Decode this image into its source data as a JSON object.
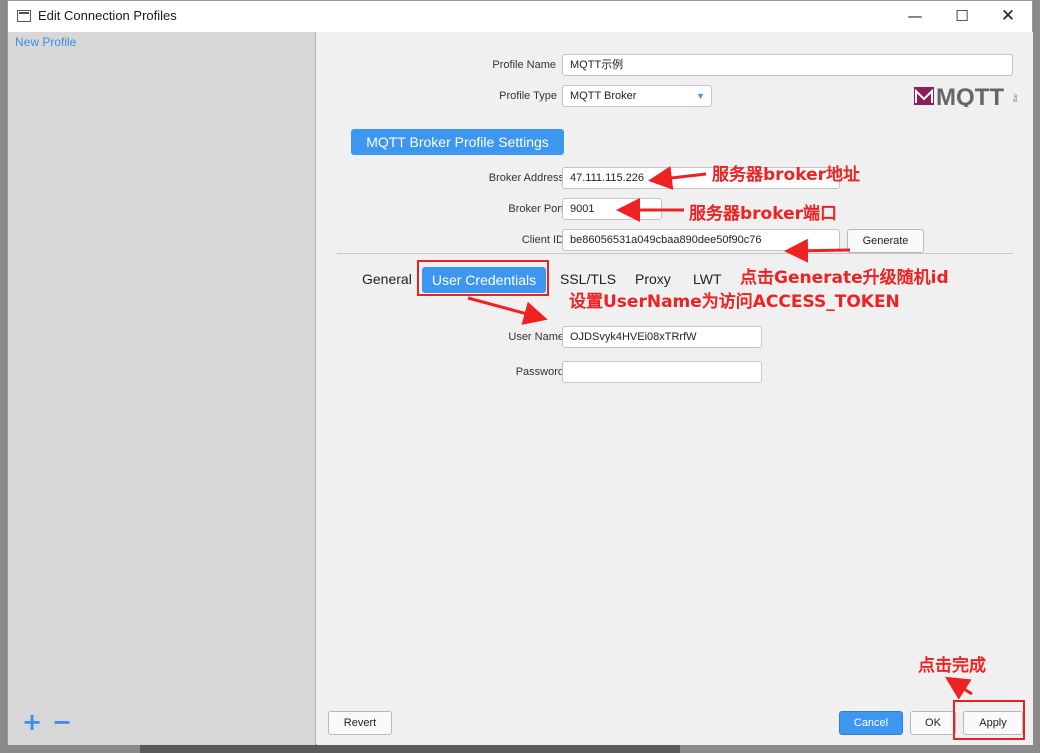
{
  "window": {
    "title": "Edit Connection Profiles"
  },
  "sidebar": {
    "items": [
      {
        "label": "New Profile"
      }
    ],
    "add": "+",
    "remove": "−"
  },
  "profile": {
    "name_label": "Profile Name",
    "name_value": "MQTT示例",
    "type_label": "Profile Type",
    "type_value": "MQTT Broker"
  },
  "logo": {
    "text": "MQTT"
  },
  "section": {
    "title": "MQTT Broker Profile Settings"
  },
  "broker": {
    "address_label": "Broker Address",
    "address_value": "47.111.115.226",
    "port_label": "Broker Port",
    "port_value": "9001",
    "client_id_label": "Client ID",
    "client_id_value": "be86056531a049cbaa890dee50f90c76",
    "generate_label": "Generate"
  },
  "tabs": [
    {
      "label": "General"
    },
    {
      "label": "User Credentials"
    },
    {
      "label": "SSL/TLS"
    },
    {
      "label": "Proxy"
    },
    {
      "label": "LWT"
    }
  ],
  "credentials": {
    "username_label": "User Name",
    "username_value": "OJDSvyk4HVEi08xTRrfW",
    "password_label": "Password",
    "password_value": ""
  },
  "footer": {
    "revert": "Revert",
    "cancel": "Cancel",
    "ok": "OK",
    "apply": "Apply"
  },
  "annotations": {
    "broker_address": "服务器broker地址",
    "broker_port": "服务器broker端口",
    "generate": "点击Generate升级随机id",
    "username": "设置UserName为访问ACCESS_TOKEN",
    "finish": "点击完成"
  },
  "colors": {
    "accent": "#3d96f0",
    "annotation": "#ee2222"
  }
}
